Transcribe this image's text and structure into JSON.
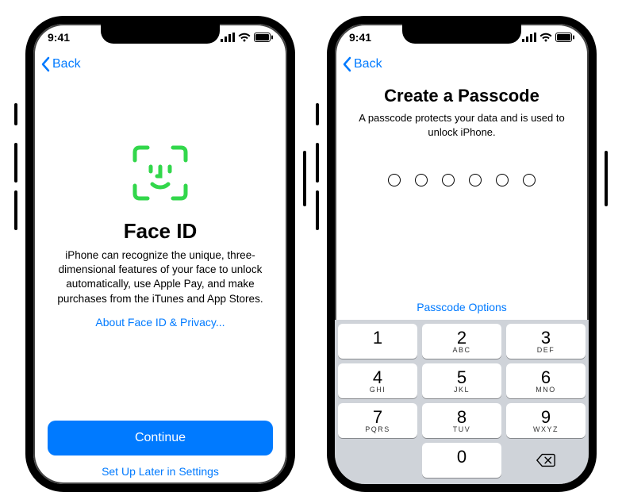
{
  "status": {
    "time": "9:41"
  },
  "nav": {
    "back": "Back"
  },
  "faceid": {
    "title": "Face ID",
    "description": "iPhone can recognize the unique, three-dimensional features of your face to unlock automatically, use Apple Pay, and make purchases from the iTunes and App Stores.",
    "privacy_link": "About Face ID & Privacy...",
    "continue": "Continue",
    "later": "Set Up Later in Settings"
  },
  "passcode": {
    "title": "Create a Passcode",
    "description": "A passcode protects your data and is used to unlock iPhone.",
    "options": "Passcode Options",
    "digit_count": 6,
    "keypad": [
      {
        "d": "1",
        "l": ""
      },
      {
        "d": "2",
        "l": "ABC"
      },
      {
        "d": "3",
        "l": "DEF"
      },
      {
        "d": "4",
        "l": "GHI"
      },
      {
        "d": "5",
        "l": "JKL"
      },
      {
        "d": "6",
        "l": "MNO"
      },
      {
        "d": "7",
        "l": "PQRS"
      },
      {
        "d": "8",
        "l": "TUV"
      },
      {
        "d": "9",
        "l": "WXYZ"
      },
      {
        "d": "0",
        "l": ""
      }
    ]
  },
  "colors": {
    "accent": "#007aff",
    "faceid_green": "#32d74b"
  }
}
